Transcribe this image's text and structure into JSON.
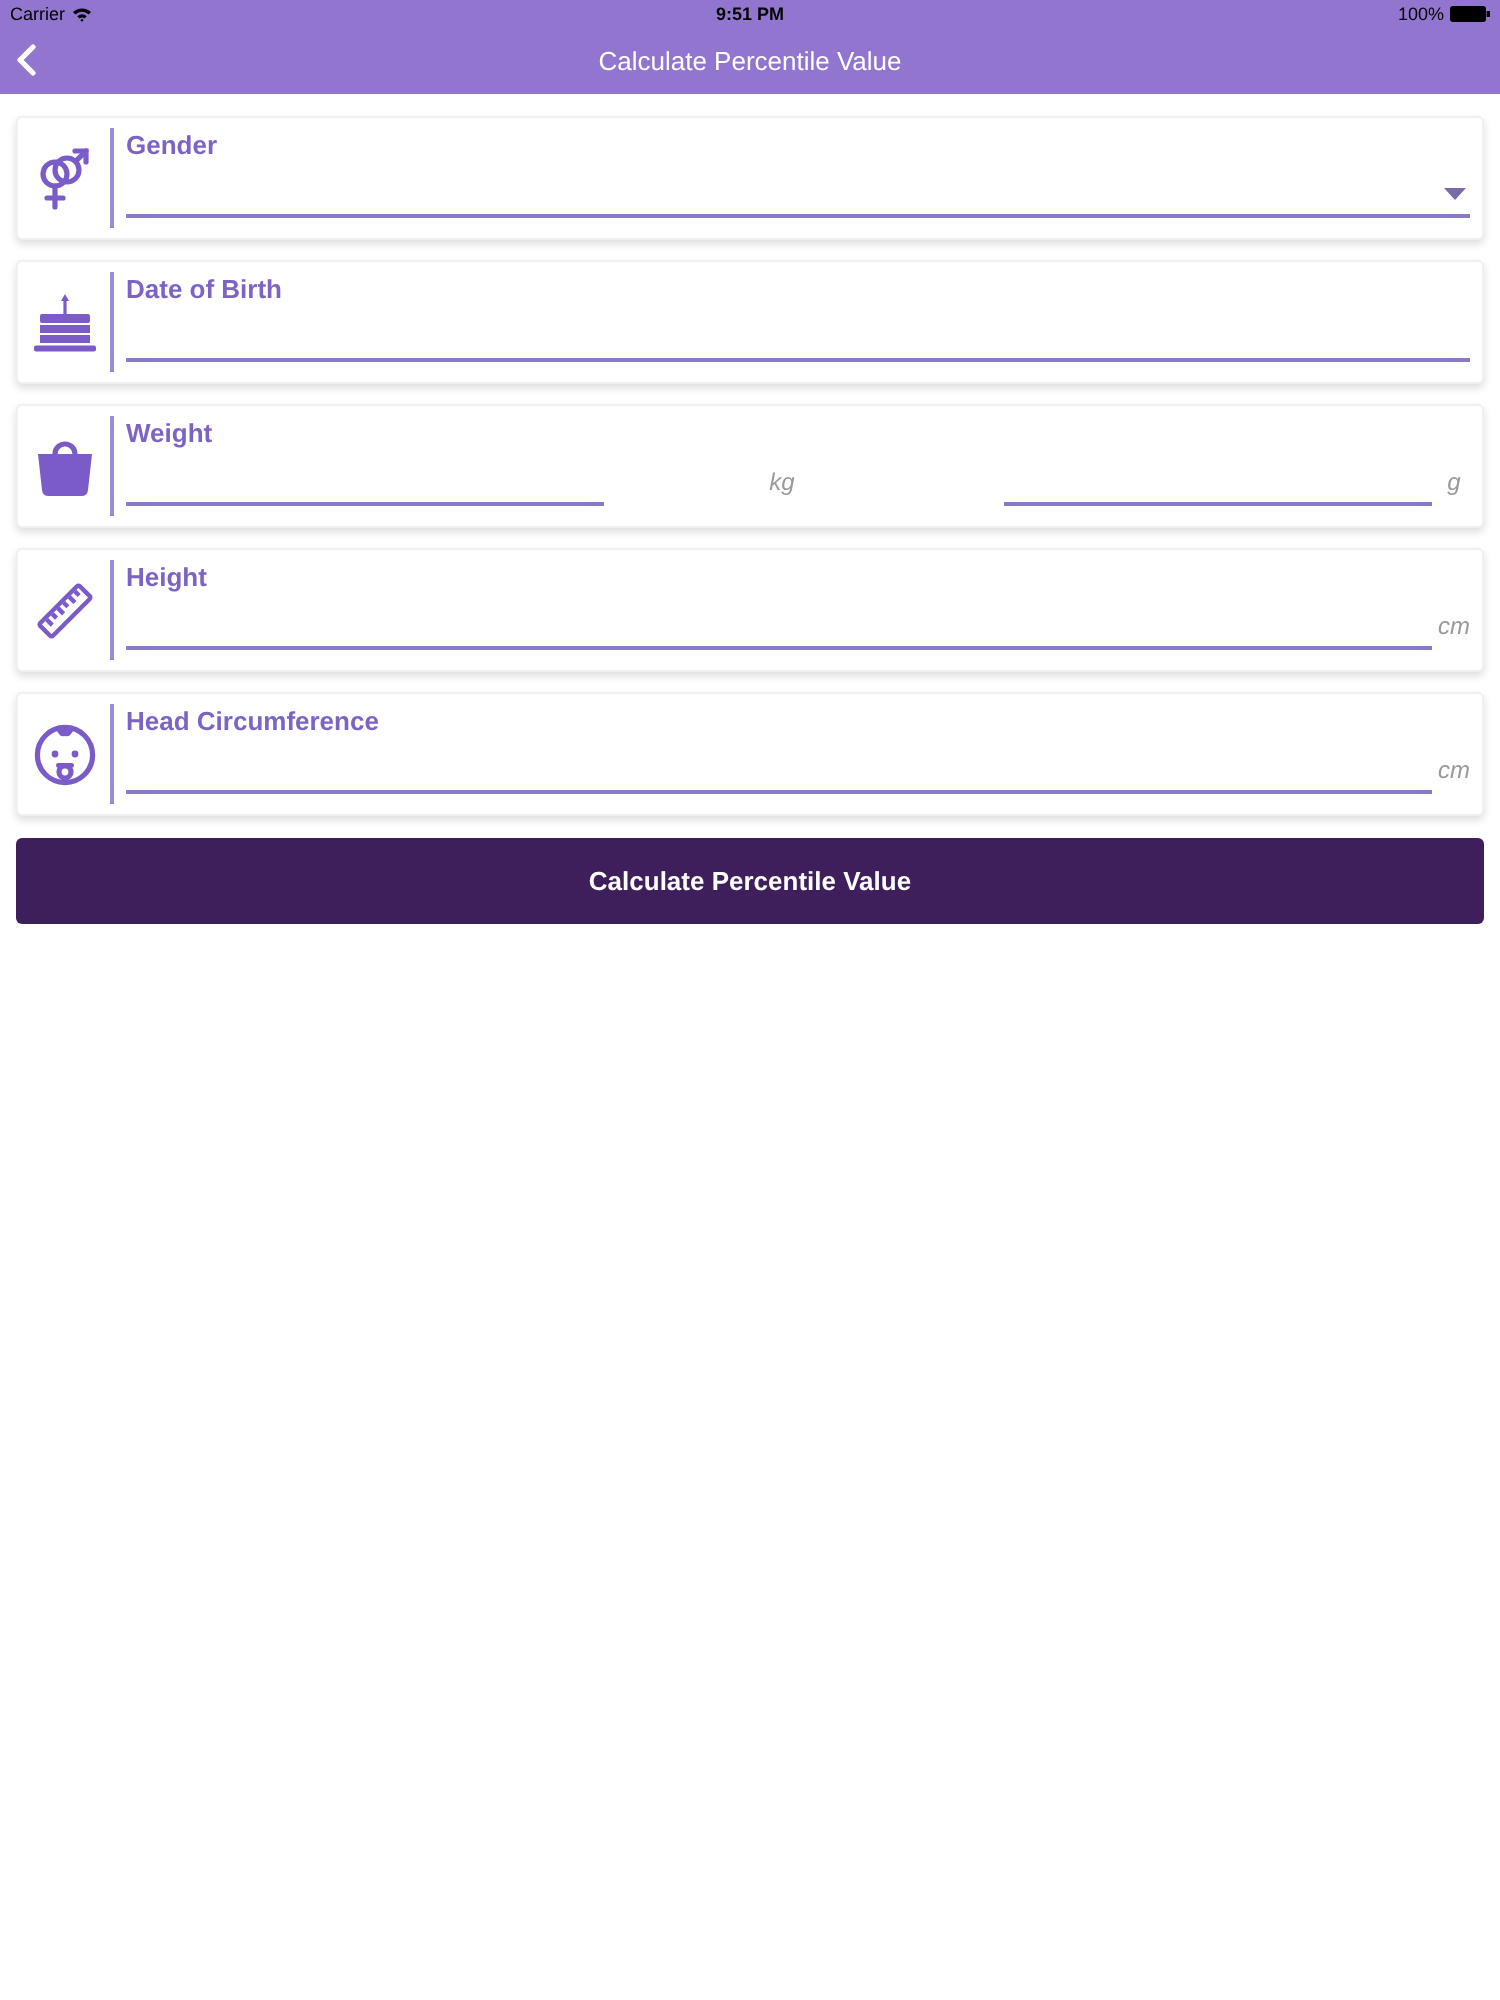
{
  "status_bar": {
    "carrier": "Carrier",
    "time": "9:51 PM",
    "battery": "100%"
  },
  "nav_bar": {
    "title": "Calculate Percentile Value"
  },
  "form": {
    "fields": [
      {
        "kind": "dropdown",
        "label": "Gender"
      },
      {
        "kind": "text",
        "label": "Date of Birth"
      },
      {
        "kind": "dual_measure",
        "label": "Weight",
        "units": [
          "kg",
          "g"
        ]
      },
      {
        "kind": "measure",
        "label": "Height",
        "unit": "cm"
      },
      {
        "kind": "measure",
        "label": "Head Circumference",
        "unit": "cm"
      }
    ]
  },
  "submit_button": {
    "label": "Calculate Percentile Value"
  }
}
